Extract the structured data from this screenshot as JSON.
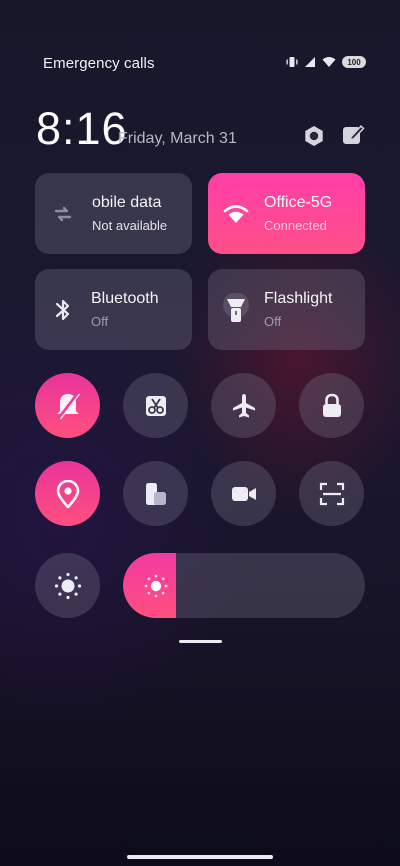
{
  "status_bar": {
    "carrier_text": "Emergency calls",
    "battery_level": "100",
    "icons": [
      "vibrate-icon",
      "signal-icon",
      "wifi-icon",
      "battery-icon"
    ]
  },
  "header": {
    "time": "8:16",
    "date": "Friday, March 31",
    "icons": [
      "settings-icon",
      "edit-icon"
    ]
  },
  "tiles": {
    "mobile_data": {
      "name": "obile data",
      "status": "Not available",
      "active": false
    },
    "wifi": {
      "name": "Office-5G",
      "status": "Connected",
      "active": true
    },
    "bluetooth": {
      "name": "Bluetooth",
      "status": "Off",
      "active": false
    },
    "flashlight": {
      "name": "Flashlight",
      "status": "Off",
      "active": false
    }
  },
  "toggles_row1": [
    {
      "icon": "silent-bell-icon",
      "active": true
    },
    {
      "icon": "screenshot-scissors-icon",
      "active": false
    },
    {
      "icon": "airplane-icon",
      "active": false
    },
    {
      "icon": "lock-icon",
      "active": false
    }
  ],
  "toggles_row2": [
    {
      "icon": "location-icon",
      "active": true
    },
    {
      "icon": "cast-screen-icon",
      "active": false
    },
    {
      "icon": "video-camera-icon",
      "active": false
    },
    {
      "icon": "scan-icon",
      "active": false
    }
  ],
  "brightness": {
    "auto_icon": "auto-brightness-icon",
    "level": 0.22
  },
  "colors": {
    "accent": "#ff3ea9",
    "accent_end": "#ff4f88",
    "tile_off": "#4a4860"
  }
}
